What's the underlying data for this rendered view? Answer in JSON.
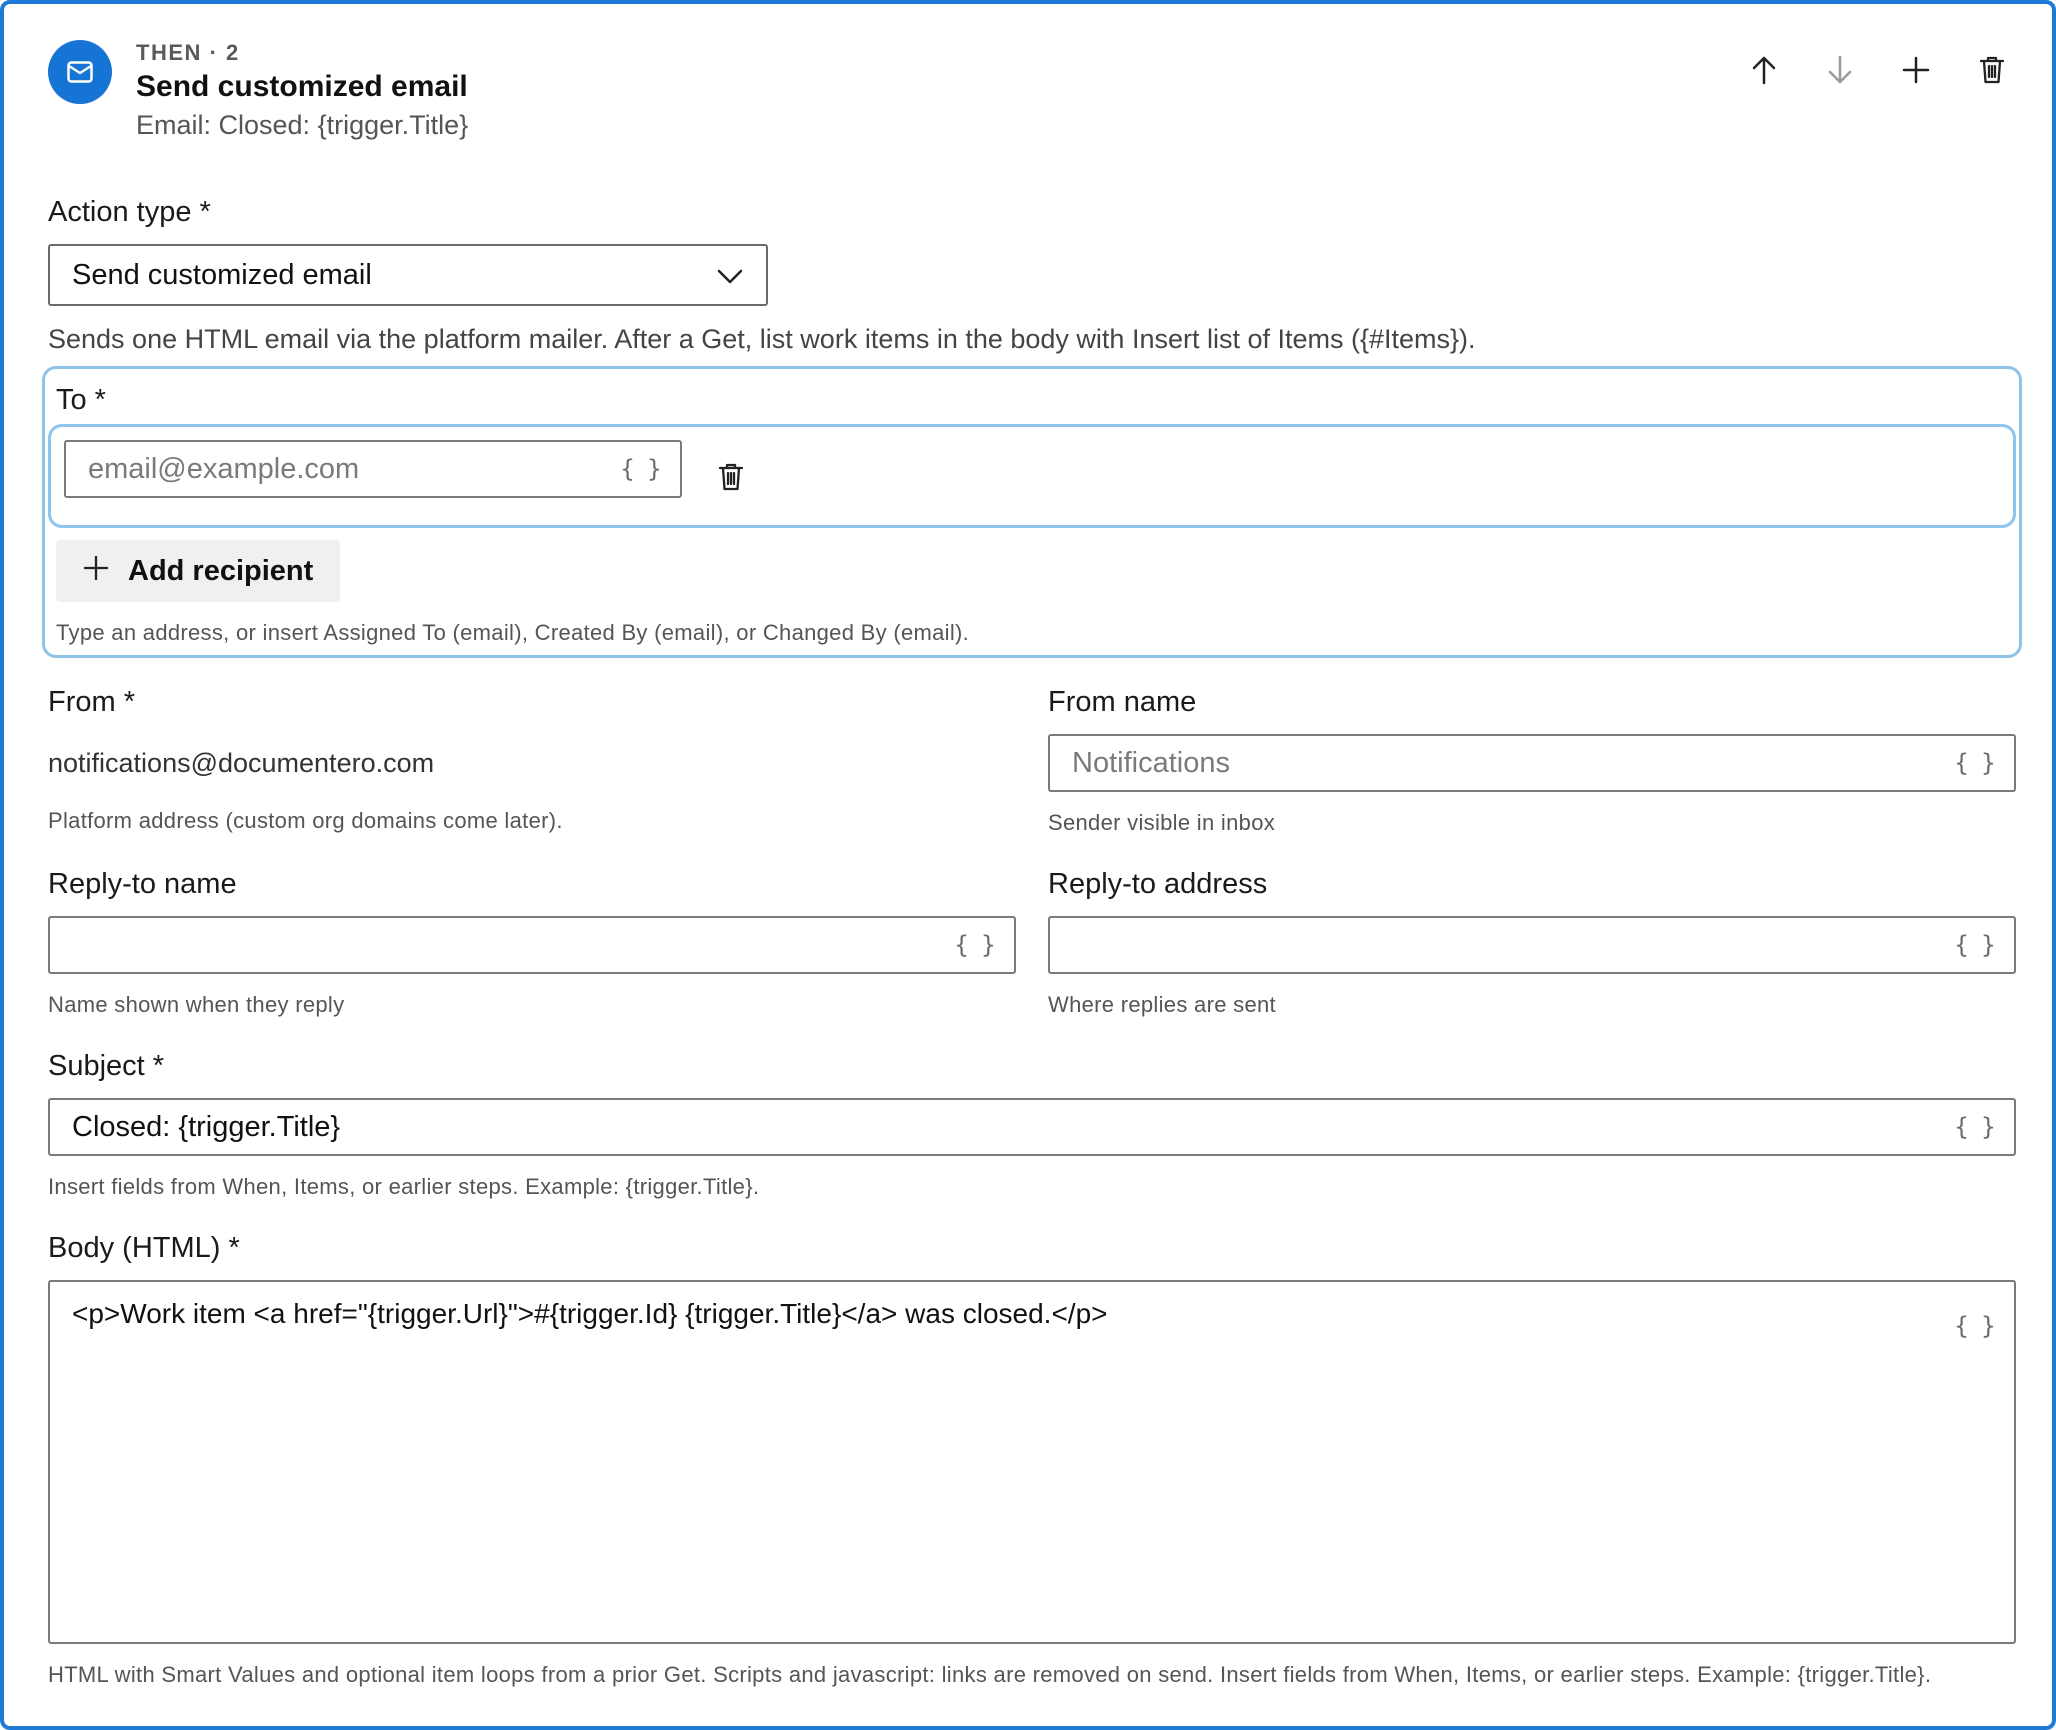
{
  "header": {
    "eyebrow": "THEN · 2",
    "title": "Send customized email",
    "subtitle": "Email: Closed: {trigger.Title}",
    "icon": "mail-icon",
    "accent_color": "#1574d4",
    "actions": [
      {
        "name": "move-up-icon"
      },
      {
        "name": "move-down-icon"
      },
      {
        "name": "add-icon"
      },
      {
        "name": "trash-icon"
      }
    ]
  },
  "action_type": {
    "label": "Action type *",
    "value": "Send customized email",
    "description": "Sends one HTML email via the platform mailer. After a Get, list work items in the body with Insert list of Items ({#Items})."
  },
  "to": {
    "label": "To *",
    "placeholder": "email@example.com",
    "value": "",
    "add_label": "Add recipient",
    "help": "Type an address, or insert Assigned To (email), Created By (email), or Changed By (email)."
  },
  "from": {
    "label": "From *",
    "value": "notifications@documentero.com",
    "help": "Platform address (custom org domains come later)."
  },
  "from_name": {
    "label": "From name",
    "placeholder": "Notifications",
    "value": "",
    "help": "Sender visible in inbox"
  },
  "reply_to_name": {
    "label": "Reply-to name",
    "value": "",
    "help": "Name shown when they reply"
  },
  "reply_to_address": {
    "label": "Reply-to address",
    "value": "",
    "help": "Where replies are sent"
  },
  "subject": {
    "label": "Subject *",
    "value": "Closed: {trigger.Title}",
    "help": "Insert fields from When, Items, or earlier steps. Example: {trigger.Title}."
  },
  "body": {
    "label": "Body (HTML) *",
    "value": "<p>Work item <a href=\"{trigger.Url}\">#{trigger.Id} {trigger.Title}</a> was closed.</p>",
    "help": "HTML with Smart Values and optional item loops from a prior Get. Scripts and javascript: links are removed on send. Insert fields from When, Items, or earlier steps. Example: {trigger.Title}."
  },
  "smart_value_icon": "{ }"
}
